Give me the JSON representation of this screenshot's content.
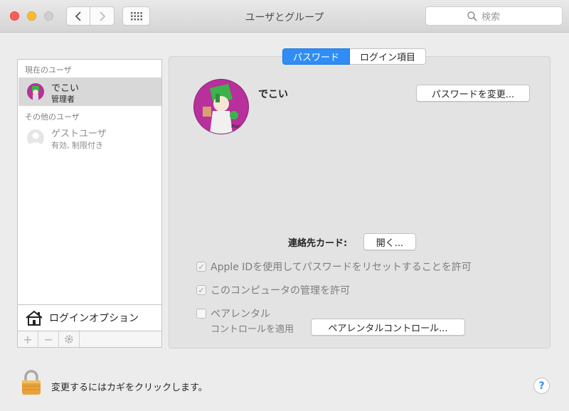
{
  "window": {
    "title": "ユーザとグループ",
    "search_placeholder": "検索"
  },
  "sidebar": {
    "current_header": "現在のユーザ",
    "current_user": {
      "name": "でこい",
      "role": "管理者"
    },
    "other_header": "その他のユーザ",
    "guest_user": {
      "name": "ゲストユーザ",
      "status": "有効, 制限付き"
    },
    "login_options": "ログインオプション",
    "add_symbol": "+",
    "remove_symbol": "−"
  },
  "tabs": [
    "パスワード",
    "ログイン項目"
  ],
  "main": {
    "user_name": "でこい",
    "change_password": "パスワードを変更...",
    "contact_card_label": "連絡先カード:",
    "open_button": "開く...",
    "apple_id_option": "Apple IDを使用してパスワードをリセットすることを許可",
    "admin_option": "このコンピュータの管理を許可",
    "parental_line1": "ペアレンタル",
    "parental_line2": "コントロールを適用",
    "parental_button": "ペアレンタルコントロール..."
  },
  "footer": {
    "lock_text": "変更するにはカギをクリックします。",
    "help_label": "?"
  },
  "icons": {
    "search": "search-icon",
    "back": "chevron-left-icon",
    "forward": "chevron-right-icon",
    "grid": "grid-icon",
    "home": "house-icon",
    "lock": "padlock-icon",
    "gear": "gear-icon"
  },
  "colors": {
    "accent": "#2f8df5",
    "avatar_bg": "#b7309b"
  }
}
